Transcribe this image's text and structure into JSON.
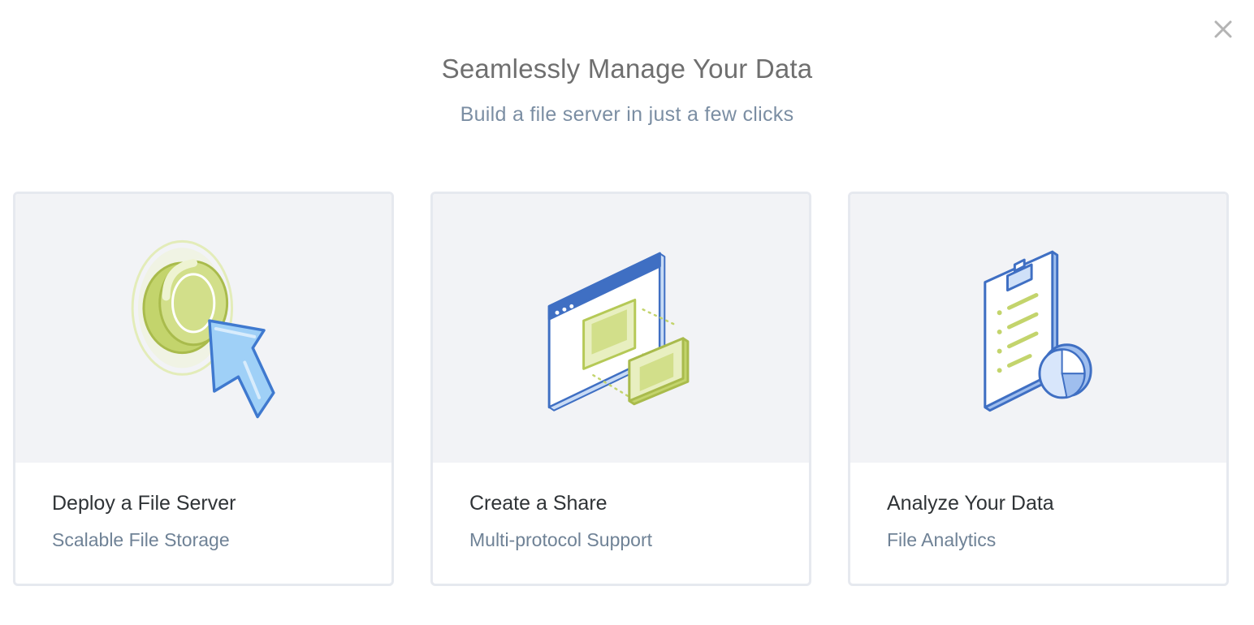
{
  "header": {
    "title": "Seamlessly Manage Your Data",
    "subtitle": "Build a file server in just a few clicks"
  },
  "close": {
    "icon": "close-icon"
  },
  "cards": [
    {
      "title": "Deploy a File Server",
      "subtitle": "Scalable File Storage",
      "icon": "click-button-icon"
    },
    {
      "title": "Create a Share",
      "subtitle": "Multi-protocol Support",
      "icon": "share-window-icon"
    },
    {
      "title": "Analyze Your Data",
      "subtitle": "File Analytics",
      "icon": "clipboard-analytics-icon"
    }
  ],
  "colors": {
    "accent_blue": "#3f6fc3",
    "light_blue": "#9fd0f7",
    "accent_green": "#c3d46c",
    "card_art_bg": "#f2f3f6",
    "card_border": "#e6e9ef"
  }
}
